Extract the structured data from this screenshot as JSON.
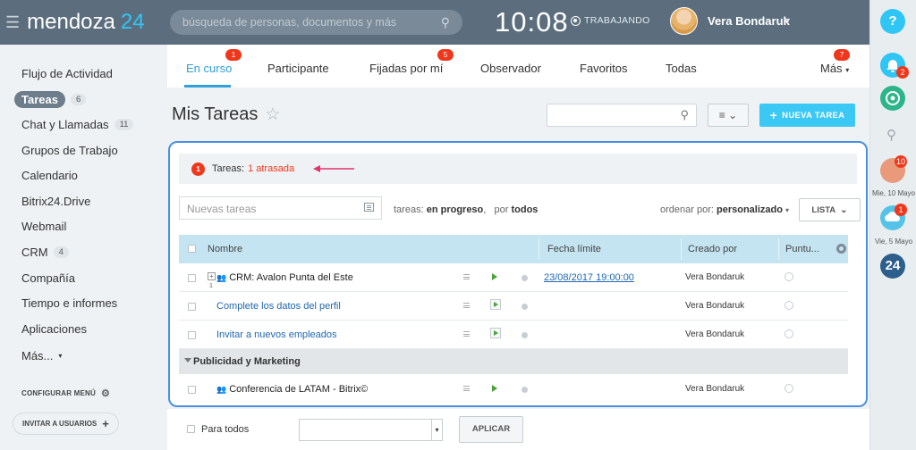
{
  "header": {
    "logo_main": "mendoza",
    "logo_accent": "24",
    "search_placeholder": "búsqueda de personas, documentos y más",
    "clock": "10:08",
    "work_status": "TRABAJANDO",
    "user_name": "Vera Bondaruk"
  },
  "sidebar": {
    "items": [
      {
        "label": "Flujo de Actividad",
        "count": ""
      },
      {
        "label": "Tareas",
        "count": "6"
      },
      {
        "label": "Chat y Llamadas",
        "count": "11"
      },
      {
        "label": "Grupos de Trabajo",
        "count": ""
      },
      {
        "label": "Calendario",
        "count": ""
      },
      {
        "label": "Bitrix24.Drive",
        "count": ""
      },
      {
        "label": "Webmail",
        "count": ""
      },
      {
        "label": "CRM",
        "count": "4"
      },
      {
        "label": "Compañía",
        "count": ""
      },
      {
        "label": "Tiempo e informes",
        "count": ""
      },
      {
        "label": "Aplicaciones",
        "count": ""
      },
      {
        "label": "Más...",
        "count": ""
      }
    ],
    "config_label": "CONFIGURAR MENÚ",
    "invite_label": "INVITAR A USUARIOS"
  },
  "tabs": [
    {
      "label": "En curso",
      "badge": "1"
    },
    {
      "label": "Participante",
      "badge": ""
    },
    {
      "label": "Fijadas por mí",
      "badge": "5"
    },
    {
      "label": "Observador",
      "badge": ""
    },
    {
      "label": "Favoritos",
      "badge": ""
    },
    {
      "label": "Todas",
      "badge": ""
    },
    {
      "label": "Más",
      "badge": "7"
    }
  ],
  "page": {
    "title": "Mis Tareas",
    "new_task_label": "NUEVA TAREA"
  },
  "panel": {
    "alert_count": "1",
    "alert_label": "Tareas:",
    "alert_overdue": "1 atrasada",
    "quick_task_placeholder": "Nuevas tareas",
    "filter_prefix": "tareas:",
    "filter_status": "en progreso",
    "filter_by_prefix": "por",
    "filter_by": "todos",
    "order_prefix": "ordenar por:",
    "order_value": "personalizado",
    "list_label": "LISTA",
    "columns": [
      "Nombre",
      "Fecha límite",
      "Creado por",
      "Puntu..."
    ],
    "rows": [
      {
        "name": "CRM: Avalon Punta del Este",
        "subcount": "1",
        "deadline": "23/08/2017 19:00:00",
        "creator": "Vera Bondaruk"
      },
      {
        "name": "Complete los datos del perfil",
        "deadline": "",
        "creator": "Vera Bondaruk"
      },
      {
        "name": "Invitar a nuevos empleados",
        "deadline": "",
        "creator": "Vera Bondaruk"
      }
    ],
    "group_label": "Publicidad y Marketing",
    "group_rows": [
      {
        "name": "Conferencia de LATAM - Bitrix©",
        "deadline": "",
        "creator": "Vera Bondaruk"
      }
    ]
  },
  "footer": {
    "for_all_label": "Para todos",
    "apply_label": "APLICAR"
  },
  "rail": {
    "help": "?",
    "bell_badge": "2",
    "avatar_badge": "10",
    "date1": "Mie, 10 Mayo",
    "cloud_badge": "1",
    "date2": "Vie, 5 Mayo",
    "app_label": "24"
  },
  "colors": {
    "topbar": "#5c6e7e",
    "accent": "#2fc6f6",
    "link": "#2067b0",
    "alert": "#f0371b",
    "panel_border": "#4a90e2"
  }
}
